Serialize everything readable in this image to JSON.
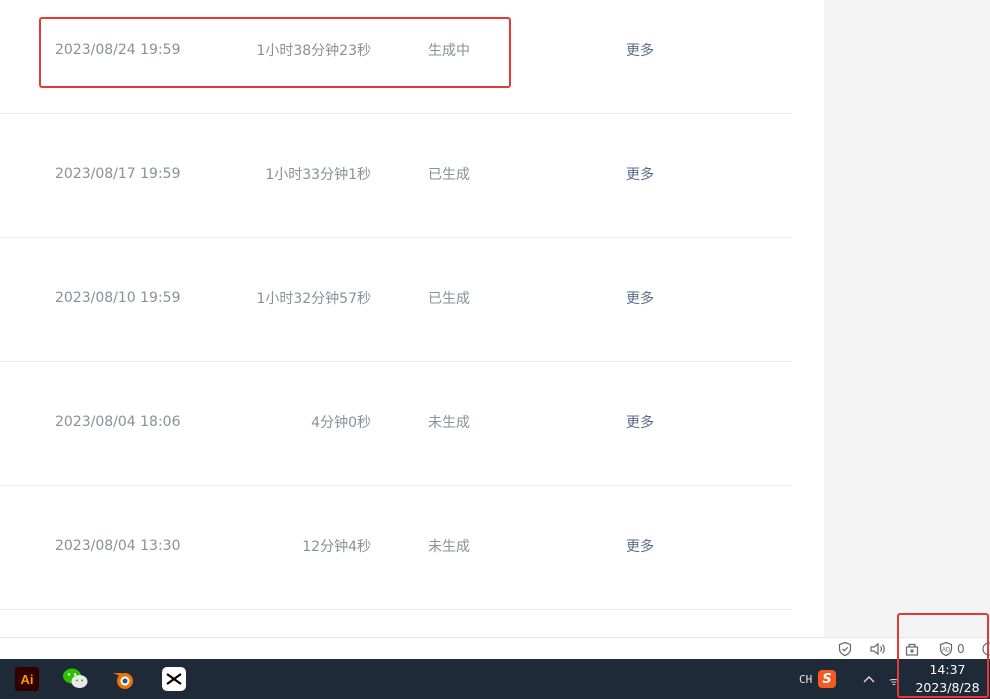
{
  "records": [
    {
      "date": "2023/08/24 19:59",
      "duration": "1小时38分钟23秒",
      "status": "生成中",
      "more": "更多"
    },
    {
      "date": "2023/08/17 19:59",
      "duration": "1小时33分钟1秒",
      "status": "已生成",
      "more": "更多"
    },
    {
      "date": "2023/08/10 19:59",
      "duration": "1小时32分钟57秒",
      "status": "已生成",
      "more": "更多"
    },
    {
      "date": "2023/08/04 18:06",
      "duration": "4分钟0秒",
      "status": "未生成",
      "more": "更多"
    },
    {
      "date": "2023/08/04 13:30",
      "duration": "12分钟4秒",
      "status": "未生成",
      "more": "更多"
    }
  ],
  "status_strip": {
    "icons": [
      "shield-check-icon",
      "speaker-icon",
      "download-box-icon",
      "adblock-shield-icon",
      "emoji-icon"
    ],
    "adblock_count": "0"
  },
  "taskbar": {
    "apps": [
      {
        "name": "Adobe Illustrator",
        "icon": "illustrator-icon",
        "label": "Ai"
      },
      {
        "name": "WeChat",
        "icon": "wechat-icon"
      },
      {
        "name": "Blender",
        "icon": "blender-icon"
      },
      {
        "name": "CapCut",
        "icon": "capcut-icon"
      }
    ],
    "ime": "CH",
    "sogou_label": "S",
    "time": "14:37",
    "date": "2023/8/28"
  },
  "colors": {
    "highlight": "#e53935",
    "taskbar": "#1f2a38",
    "text_muted": "#8a8f99",
    "link": "#5a6b8c"
  }
}
